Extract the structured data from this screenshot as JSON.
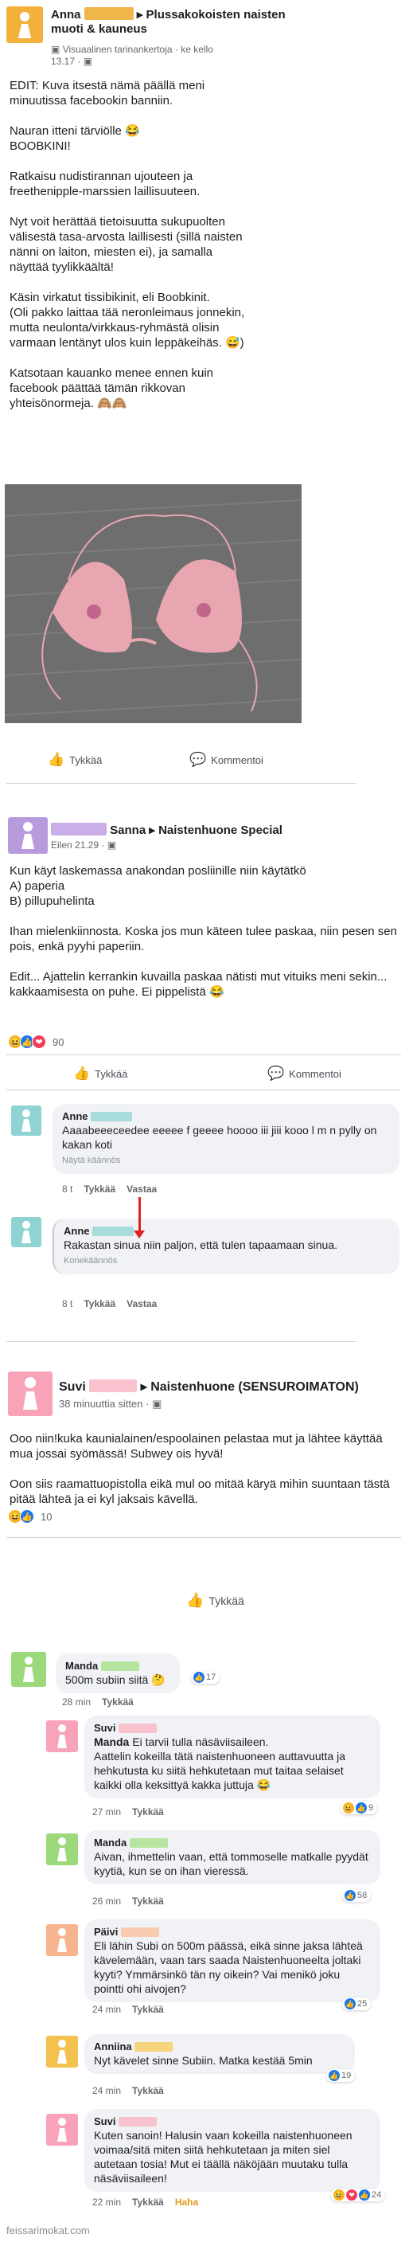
{
  "colors": {
    "female_pink": "#f8a3b7",
    "female_purple": "#b79bdc",
    "female_teal": "#8fd3d3",
    "female_green": "#9cd97b",
    "female_yellow": "#f2b23c",
    "female_orange": "#f6b58f",
    "link_blue": "#1877f2",
    "red_arrow": "#e02020"
  },
  "post1": {
    "author": "Anna",
    "group": "Plussakokoisten naisten muoti & kauneus",
    "subtitle": "Visuaalinen tarinankertoja · ke kello",
    "time": "13.17 ·",
    "body": "EDIT: Kuva itsestä nämä päällä meni minuutissa facebookin banniin.\n\nNauran itteni tärviölle 😂\nBOOBKINI!\n\nRatkaisu nudistirannan ujouteen ja freethenipple-marssien laillisuuteen.\n\nNyt voit herättää tietoisuutta sukupuolten välisestä tasa-arvosta laillisesti (sillä naisten nänni on laiton, miesten ei), ja samalla näyttää tyylikkäältä!\n\nKäsin virkatut tissibikinit, eli Boobkinit.\n(Oli pakko laittaa tää neronleimaus jonnekin, mutta neulonta/virkkaus-ryhmästä olisin varmaan lentänyt ulos kuin leppäkeihäs. 😅)\n\nKatsotaan kauanko menee ennen kuin facebook päättää tämän rikkovan yhteisönormeja. 🙈🙈",
    "like_label": "Tykkää",
    "comment_label": "Kommentoi"
  },
  "post2": {
    "author": "Sanna",
    "group": "Naistenhuone Special",
    "time": "Eilen 21.29 ·",
    "body": "Kun käyt laskemassa anakondan posliinille niin käytätkö\nA) paperia\nB) pillupuhelinta\n\nIhan mielenkiinnosta. Koska jos mun käteen tulee paskaa, niin pesen sen pois, enkä pyyhi paperiin.\n\nEdit... Ajattelin kerrankin kuvailla paskaa nätisti mut vituiks meni sekin... kakkaamisesta on puhe. Ei pippelistä 😂",
    "reaction_count": "90",
    "like_label": "Tykkää",
    "comment_label": "Kommentoi",
    "comments": [
      {
        "author": "Anne",
        "text": "Aaaabeeeceedee eeeee f geeee hoooo iii jiii kooo l m n pylly on kakan koti",
        "note": "Näytä käännös",
        "time": "8 t",
        "like": "Tykkää",
        "reply": "Vastaa"
      },
      {
        "author": "Anne",
        "text": "Rakastan sinua niin paljon, että tulen tapaamaan sinua.",
        "note": "Konekäännös",
        "time": "8 t",
        "like": "Tykkää",
        "reply": "Vastaa"
      }
    ]
  },
  "post3": {
    "author": "Suvi",
    "group": "Naistenhuone (SENSUROIMATON)",
    "time": "38 minuuttia sitten ·",
    "body": "Ooo niin!kuka kaunialainen/espoolainen pelastaa mut ja lähtee käyttää mua jossai syömässä! Subwey ois hyvä!\n\nOon siis raamattuopistolla eikä mul oo mitää käryä mihin suuntaan tästä pitää lähteä ja ei kyl jaksais kävellä.",
    "reaction_count": "10",
    "like_label": "Tykkää",
    "comments": [
      {
        "author": "Manda",
        "mention": "",
        "text": "500m subiin siitä 🤔",
        "time": "28 min",
        "like": "Tykkää",
        "react_count": "17",
        "haha": ""
      },
      {
        "author": "Suvi",
        "mention": "Manda",
        "text": "Ei tarvii tulla näsäviisaileen.\nAattelin kokeilla tätä naistenhuoneen auttavuutta ja hehkutusta ku siitä hehkutetaan mut taitaa selaiset kaikki olla keksittyä kakka juttuja 😂",
        "time": "27 min",
        "like": "Tykkää",
        "react_count": "9",
        "haha": ""
      },
      {
        "author": "Manda",
        "mention": "",
        "text": "Aivan, ihmettelin vaan, että tommoselle matkalle pyydät kyytiä, kun se on ihan vieressä.",
        "time": "26 min",
        "like": "Tykkää",
        "react_count": "58",
        "haha": ""
      },
      {
        "author": "Päivi",
        "mention": "",
        "text": "Eli lähin Subi on 500m päässä, eikä sinne jaksa lähteä kävelemään, vaan tars saada Naistenhuoneelta joltaki kyyti? Ymmärsinkö tän ny oikein? Vai menikö joku pointti ohi aivojen?",
        "time": "24 min",
        "like": "Tykkää",
        "react_count": "25",
        "haha": ""
      },
      {
        "author": "Anniina",
        "mention": "",
        "text": "Nyt kävelet sinne Subiin. Matka kestää 5min",
        "time": "24 min",
        "like": "Tykkää",
        "react_count": "19",
        "haha": ""
      },
      {
        "author": "Suvi",
        "mention": "",
        "text": "Kuten sanoin! Halusin vaan kokeilla naistenhuoneen voimaa/sitä miten siitä hehkutetaan ja miten siel autetaan tosia! Mut ei täällä näköjään muutaku tulla näsäviisaileen!",
        "time": "22 min",
        "like": "Tykkää",
        "react_count": "24",
        "haha": "Haha"
      }
    ]
  },
  "watermark": "feissarimokat.com"
}
